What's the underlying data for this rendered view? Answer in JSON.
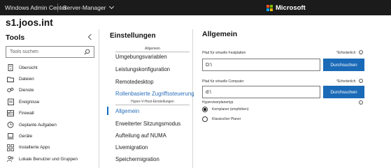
{
  "topbar": {
    "app_title": "Windows Admin Center",
    "tool_switch": "Server-Manager",
    "brand": "Microsoft"
  },
  "colors": {
    "topbar_bg": "#1b1b1b",
    "accent": "#1a6ab8",
    "link": "#2a6ebb",
    "ms_red": "#f25022",
    "ms_green": "#7fba00",
    "ms_blue": "#00a4ef",
    "ms_yellow": "#ffb900"
  },
  "server_name": "s1.joos.int",
  "tools": {
    "title": "Tools",
    "search_placeholder": "Tools suchen",
    "items": [
      {
        "label": "Übersicht",
        "icon": "server-icon"
      },
      {
        "label": "Dateien",
        "icon": "folder-icon"
      },
      {
        "label": "Dienste",
        "icon": "services-icon"
      },
      {
        "label": "Ereignisse",
        "icon": "events-icon"
      },
      {
        "label": "Firewall",
        "icon": "firewall-icon"
      },
      {
        "label": "Geplante Aufgaben",
        "icon": "clock-icon"
      },
      {
        "label": "Geräte",
        "icon": "devices-icon"
      },
      {
        "label": "Installierte Apps",
        "icon": "apps-icon"
      },
      {
        "label": "Lokale Benutzer und Gruppen",
        "icon": "users-icon"
      }
    ]
  },
  "settings": {
    "title": "Einstellungen",
    "group_general": "Allgemein",
    "general_items": [
      "Umgebungsvariablen",
      "Leistungskonfiguration",
      "Remotedesktop",
      "Rollenbasierte Zugriffssteuerung"
    ],
    "group_hyperv": "Hyper-V-Host-Einstellungen",
    "hyperv_items": [
      "Allgemein",
      "Erweiterter Sitzungsmodus",
      "Aufteilung auf NUMA",
      "Livemigration",
      "Speichermigration"
    ]
  },
  "main": {
    "title": "Allgemein",
    "disk_path": {
      "label": "Pfad für virtuelle Festplatten",
      "required": "*Erforderlich",
      "value": "D:\\",
      "browse": "Durchsuchen"
    },
    "vm_path": {
      "label": "Pfad für virtuelle Computer",
      "required": "*Erforderlich",
      "value": "d:\\",
      "browse": "Durchsuchen"
    },
    "scheduler": {
      "label": "Hypervisorplanertyp",
      "options": [
        "Kernplaner (empfohlen)",
        "Klassischer Planer"
      ],
      "selected": "Kernplaner (empfohlen)"
    }
  }
}
